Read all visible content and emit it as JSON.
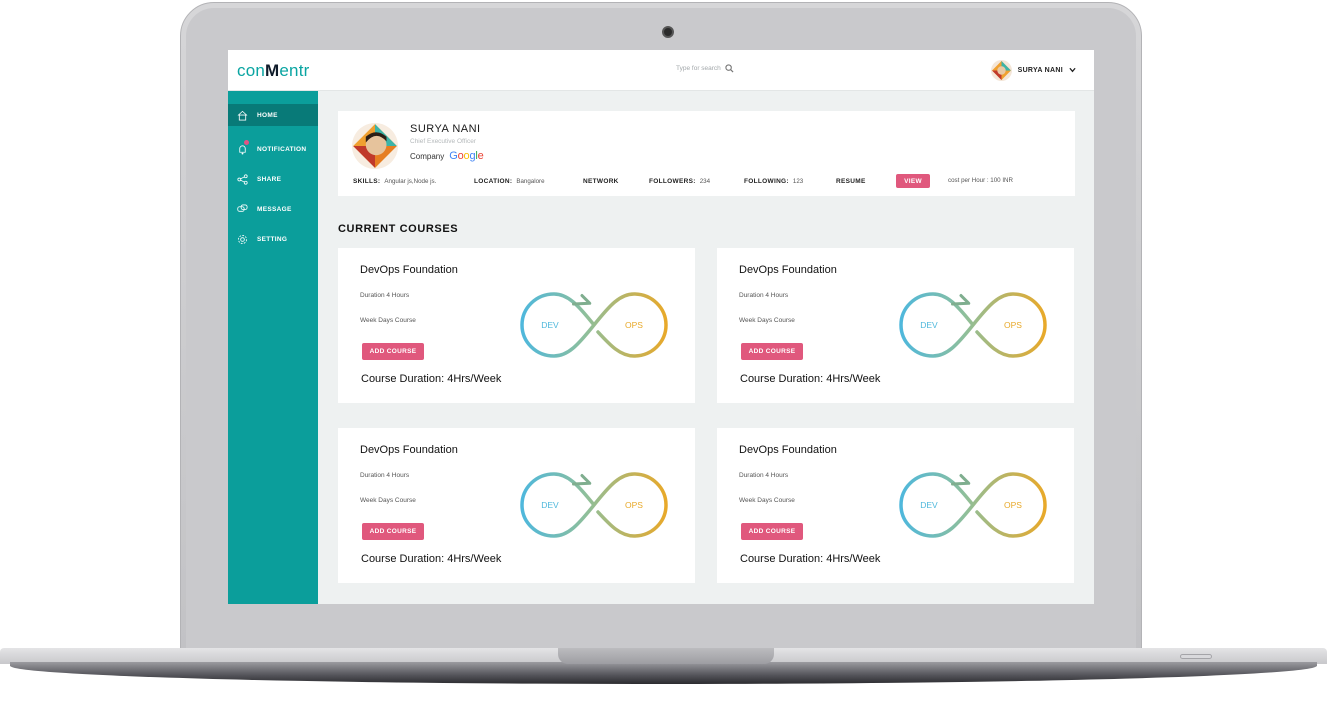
{
  "header": {
    "logo_part1": "con",
    "logo_part2": "M",
    "logo_part3": "entr",
    "search_placeholder": "Type for search",
    "user_name": "SURYA NANI"
  },
  "sidebar": {
    "items": [
      {
        "label": "HOME",
        "icon": "home-icon"
      },
      {
        "label": "NOTIFICATION",
        "icon": "notification-icon"
      },
      {
        "label": "SHARE",
        "icon": "share-icon"
      },
      {
        "label": "MESSAGE",
        "icon": "message-icon"
      },
      {
        "label": "SETTING",
        "icon": "gear-icon"
      }
    ]
  },
  "profile": {
    "name": "SURYA NANI",
    "role": "Chief Executive Officer",
    "company_label": "Company",
    "company_logo_letters": [
      "G",
      "o",
      "o",
      "g",
      "l",
      "e"
    ],
    "skills_label": "SKILLS:",
    "skills_value": "Angular js,Node js.",
    "location_label": "LOCATION:",
    "location_value": "Bangalore",
    "network_label": "NETWORK",
    "followers_label": "FOLLOWERS:",
    "followers_value": "234",
    "following_label": "FOLLOWING:",
    "following_value": "123",
    "resume_label": "RESUME",
    "view_button": "VIEW",
    "cost": "cost per Hour : 100 INR"
  },
  "courses_section": {
    "title": "CURRENT COURSES",
    "courses": [
      {
        "title": "DevOps Foundation",
        "duration": "Duration 4 Hours",
        "schedule": "Week Days Course",
        "button": "ADD COURSE",
        "course_duration": "Course Duration: 4Hrs/Week",
        "dev_label": "DEV",
        "ops_label": "OPS"
      },
      {
        "title": "DevOps Foundation",
        "duration": "Duration 4 Hours",
        "schedule": "Week Days Course",
        "button": "ADD COURSE",
        "course_duration": "Course Duration: 4Hrs/Week",
        "dev_label": "DEV",
        "ops_label": "OPS"
      },
      {
        "title": "DevOps Foundation",
        "duration": "Duration 4 Hours",
        "schedule": "Week Days Course",
        "button": "ADD COURSE",
        "course_duration": "Course Duration: 4Hrs/Week",
        "dev_label": "DEV",
        "ops_label": "OPS"
      },
      {
        "title": "DevOps Foundation",
        "duration": "Duration 4 Hours",
        "schedule": "Week Days Course",
        "button": "ADD COURSE",
        "course_duration": "Course Duration: 4Hrs/Week",
        "dev_label": "DEV",
        "ops_label": "OPS"
      }
    ]
  },
  "colors": {
    "accent_teal": "#0b9e9b",
    "sidebar_active": "#087a78",
    "button_pink": "#e0587d",
    "dev_blue": "#4fb8dc",
    "ops_orange": "#e8a92a"
  }
}
